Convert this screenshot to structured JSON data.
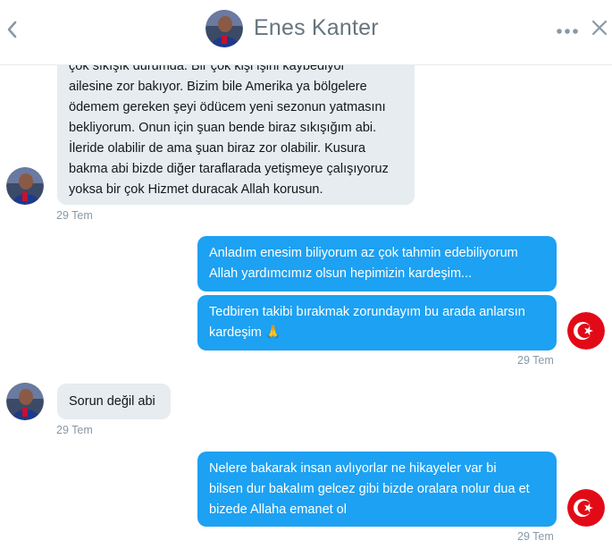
{
  "conversation": {
    "name": "Enes Kanter"
  },
  "messages": [
    {
      "direction": "received",
      "text": "çok sıkışık durumda. Bir çok kişi işini kaybediyor\nailesine zor bakıyor. Bizim bile Amerika ya bölgelere\nödemem gereken şeyi ödücem yeni sezonun yatmasını\nbekliyorum. Onun için şuan bende biraz sıkışığım abi.\nİleride olabilir de ama şuan biraz zor olabilir. Kusura\nbakma abi bizde diğer taraflarada yetişmeye çalışıyoruz\nyoksa bir çok Hizmet duracak Allah korusun.",
      "timestamp": "29 Tem"
    },
    {
      "direction": "sent",
      "text": "Anladım enesim biliyorum az çok tahmin edebiliyorum\nAllah yardımcımız olsun hepimizin kardeşim..."
    },
    {
      "direction": "sent",
      "text": "Tedbiren takibi bırakmak zorundayım bu arada anlarsın\nkardeşim 🙏",
      "timestamp": "29 Tem"
    },
    {
      "direction": "received",
      "text": "Sorun değil abi",
      "timestamp": "29 Tem"
    },
    {
      "direction": "sent",
      "text": "Nelere bakarak insan avlıyorlar ne hikayeler var bi\nbilsen dur bakalım gelcez gibi bizde oralara nolur dua et\nbizede Allaha emanet ol",
      "timestamp": "29 Tem"
    }
  ],
  "colors": {
    "sent_bubble": "#1da1f2",
    "received_bubble": "#e6ecf0",
    "header_text": "#66757f",
    "timestamp": "#8899a6",
    "flag_red": "#e30a17"
  },
  "icons": {
    "back": "chevron-left-icon",
    "more": "more-dots-icon",
    "close": "close-icon",
    "sender_avatar": "turkish-flag-avatar",
    "contact_avatar": "enes-kanter-avatar",
    "emoji": "folded-hands"
  }
}
